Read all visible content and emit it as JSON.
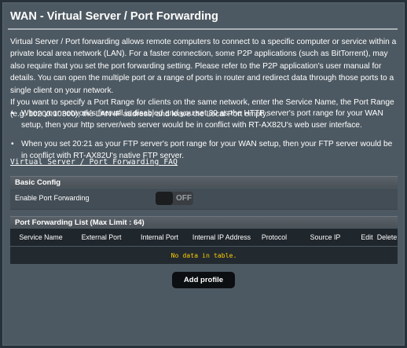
{
  "page": {
    "title": "WAN - Virtual Server / Port Forwarding"
  },
  "description": {
    "p1": "Virtual Server / Port forwarding allows remote computers to connect to a specific computer or service within a private local area network (LAN). For a faster connection, some P2P applications (such as BitTorrent), may also require that you set the port forwarding setting. Please refer to the P2P application's user manual for details. You can open the multiple port or a range of ports in router and redirect data through those ports to a single client on your network.",
    "p2": "If you want to specify a Port Range for clients on the same network, enter the Service Name, the Port Range (e.g. 10200:10300), the LAN IP address, and leave the Local Port empty."
  },
  "bullets": [
    "When your network's firewall is disabled and you set 80 as the HTTP server's port range for your WAN setup, then your http server/web server would be in conflict with RT-AX82U's web user interface.",
    "When you set 20:21 as your FTP server's port range for your WAN setup, then your FTP server would be in conflict with RT-AX82U's native FTP server."
  ],
  "faq_link": "Virtual Server / Port Forwarding FAQ",
  "basic_config": {
    "header": "Basic Config",
    "enable_label": "Enable Port Forwarding",
    "toggle_state": "OFF"
  },
  "port_list": {
    "header": "Port Forwarding List (Max Limit : 64)",
    "columns": [
      "Service Name",
      "External Port",
      "Internal Port",
      "Internal IP Address",
      "Protocol",
      "Source IP",
      "Edit",
      "Delete"
    ],
    "empty_message": "No data in table."
  },
  "add_button": "Add profile",
  "colors": {
    "background": "#26313a",
    "panel": "#4d5962",
    "empty_text": "#ffcc00"
  }
}
